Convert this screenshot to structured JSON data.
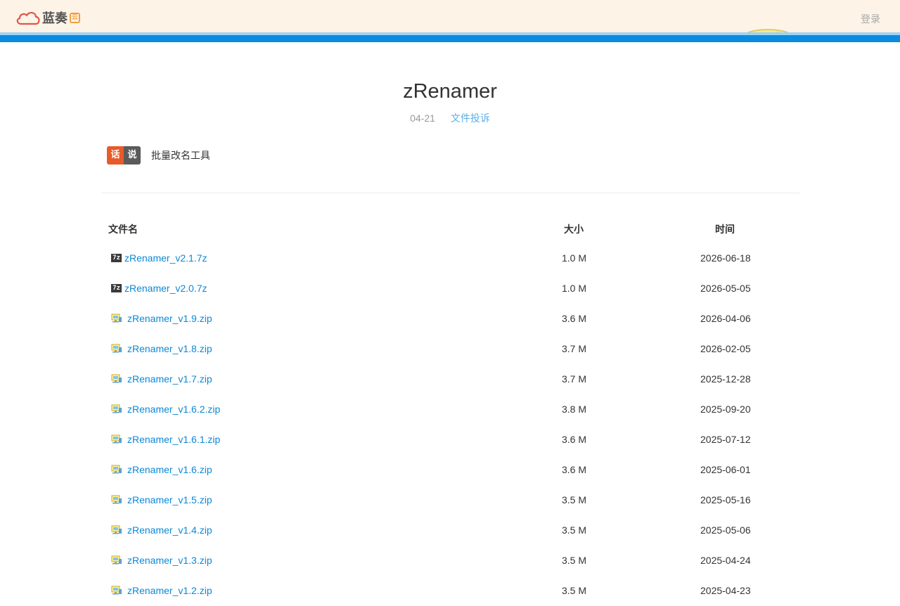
{
  "header": {
    "logo_text": "蓝奏",
    "logo_badge": "云",
    "login_label": "登录"
  },
  "file_page": {
    "title": "zRenamer",
    "date": "04-21",
    "report_label": "文件投诉",
    "badge_left": "话",
    "badge_right": "说",
    "description": "批量改名工具"
  },
  "table": {
    "headers": {
      "name": "文件名",
      "size": "大小",
      "time": "时间"
    },
    "rows": [
      {
        "name": "zRenamer_v2.1.7z",
        "size": "1.0 M",
        "time": "2026-06-18",
        "icon": "7z-archive-icon"
      },
      {
        "name": "zRenamer_v2.0.7z",
        "size": "1.0 M",
        "time": "2026-05-05",
        "icon": "7z-archive-icon"
      },
      {
        "name": "zRenamer_v1.9.zip",
        "size": "3.6 M",
        "time": "2026-04-06",
        "icon": "zip-file-icon"
      },
      {
        "name": "zRenamer_v1.8.zip",
        "size": "3.7 M",
        "time": "2026-02-05",
        "icon": "zip-file-icon"
      },
      {
        "name": "zRenamer_v1.7.zip",
        "size": "3.7 M",
        "time": "2025-12-28",
        "icon": "zip-file-icon"
      },
      {
        "name": "zRenamer_v1.6.2.zip",
        "size": "3.8 M",
        "time": "2025-09-20",
        "icon": "zip-file-icon"
      },
      {
        "name": "zRenamer_v1.6.1.zip",
        "size": "3.6 M",
        "time": "2025-07-12",
        "icon": "zip-file-icon"
      },
      {
        "name": "zRenamer_v1.6.zip",
        "size": "3.6 M",
        "time": "2025-06-01",
        "icon": "zip-file-icon"
      },
      {
        "name": "zRenamer_v1.5.zip",
        "size": "3.5 M",
        "time": "2025-05-16",
        "icon": "zip-file-icon"
      },
      {
        "name": "zRenamer_v1.4.zip",
        "size": "3.5 M",
        "time": "2025-05-06",
        "icon": "zip-file-icon"
      },
      {
        "name": "zRenamer_v1.3.zip",
        "size": "3.5 M",
        "time": "2025-04-24",
        "icon": "zip-file-icon"
      },
      {
        "name": "zRenamer_v1.2.zip",
        "size": "3.5 M",
        "time": "2025-04-23",
        "icon": "zip-file-icon"
      }
    ]
  },
  "colors": {
    "topbar_bg": "#fdf3e7",
    "accent_blue": "#0a8be0",
    "link": "#0b88d6",
    "badge_orange": "#e85a29",
    "badge_gray": "#5b5b5b"
  }
}
